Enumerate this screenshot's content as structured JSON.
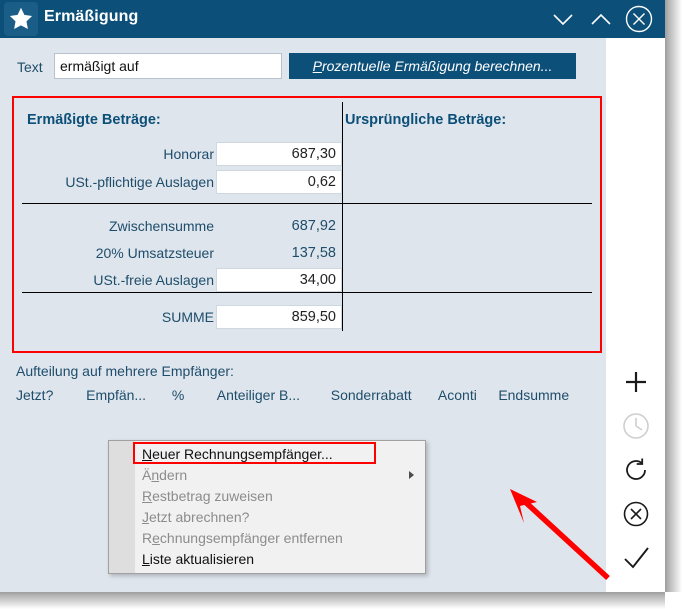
{
  "window": {
    "title": "Ermäßigung",
    "star_icon": "star-icon",
    "controls": [
      {
        "name": "minimize-button",
        "icon": "chevron-down-icon"
      },
      {
        "name": "maximize-button",
        "icon": "chevron-up-icon"
      },
      {
        "name": "close-button",
        "icon": "close-circle-icon"
      }
    ]
  },
  "form": {
    "text_label": "Text",
    "text_value": "ermäßigt auf",
    "text_placeholder": "",
    "calc_button": {
      "accel": "P",
      "rest": "rozentuelle Ermäßigung berechnen...",
      "full_label": "Prozentuelle Ermäßigung berechnen..."
    }
  },
  "amounts": {
    "header_left": "Ermäßigte Beträge:",
    "header_right": "Ursprüngliche Beträge:",
    "rows": [
      {
        "label": "Honorar",
        "value": "687,30",
        "editable": true
      },
      {
        "label": "USt.-pflichtige Auslagen",
        "value": "0,62",
        "editable": true
      },
      {
        "label": "Zwischensumme",
        "value": "687,92",
        "editable": false
      },
      {
        "label": "20% Umsatzsteuer",
        "value": "137,58",
        "editable": false
      },
      {
        "label": "USt.-freie Auslagen",
        "value": "34,00",
        "editable": true
      },
      {
        "label": "SUMME",
        "value": "859,50",
        "editable": true
      }
    ]
  },
  "split": {
    "title": "Aufteilung auf mehrere Empfänger:",
    "columns": [
      "Jetzt?",
      "Empfän...",
      "%",
      "Anteiliger B...",
      "Sonderrabatt",
      "Aconti",
      "Endsumme"
    ]
  },
  "side_actions": [
    {
      "name": "add-button",
      "icon": "plus-icon",
      "enabled": true
    },
    {
      "name": "history-button",
      "icon": "clock-icon",
      "enabled": false
    },
    {
      "name": "refresh-button",
      "icon": "refresh-icon",
      "enabled": true
    },
    {
      "name": "cancel-button",
      "icon": "close-circle-icon",
      "enabled": true
    },
    {
      "name": "confirm-button",
      "icon": "check-icon",
      "enabled": true
    }
  ],
  "context_menu": {
    "items": [
      {
        "accel": "N",
        "rest": "euer Rechnungsempfänger...",
        "full_label": "Neuer Rechnungsempfänger...",
        "enabled": true,
        "submenu": false,
        "highlighted": true
      },
      {
        "pre": "Ä",
        "accel": "n",
        "rest": "dern",
        "full_label": "Ändern",
        "enabled": false,
        "submenu": true,
        "highlighted": false
      },
      {
        "accel": "R",
        "rest": "estbetrag zuweisen",
        "full_label": "Restbetrag zuweisen",
        "enabled": false,
        "submenu": false,
        "highlighted": false
      },
      {
        "accel": "J",
        "rest": "etzt abrechnen?",
        "full_label": "Jetzt abrechnen?",
        "enabled": false,
        "submenu": false,
        "highlighted": false
      },
      {
        "pre": "R",
        "accel": "e",
        "rest": "chnungsempfänger entfernen",
        "full_label": "Rechnungsempfänger entfernen",
        "enabled": false,
        "submenu": false,
        "highlighted": false
      },
      {
        "accel": "L",
        "rest": "iste aktualisieren",
        "full_label": "Liste aktualisieren",
        "enabled": true,
        "submenu": false,
        "highlighted": false
      }
    ]
  },
  "annotations": {
    "highlight_color": "#ff0000",
    "arrow_color": "#ff0000"
  },
  "colors": {
    "titlebar": "#0c4f79",
    "panel": "#dfe5ec",
    "accent_text": "#1e4d6b",
    "header_text": "#0c4f79",
    "field_bg": "#ffffff"
  }
}
